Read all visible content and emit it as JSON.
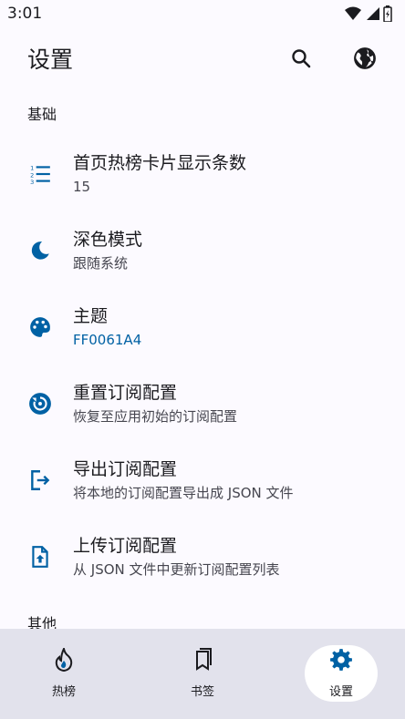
{
  "status_bar": {
    "time": "3:01"
  },
  "header": {
    "title": "设置"
  },
  "sections": {
    "basic": "基础",
    "other": "其他"
  },
  "settings": [
    {
      "title": "首页热榜卡片显示条数",
      "subtitle": "15",
      "icon": "list-numbered-icon"
    },
    {
      "title": "深色模式",
      "subtitle": "跟随系统",
      "icon": "moon-icon"
    },
    {
      "title": "主题",
      "subtitle": "FF0061A4",
      "icon": "palette-icon"
    },
    {
      "title": "重置订阅配置",
      "subtitle": "恢复至应用初始的订阅配置",
      "icon": "reset-icon"
    },
    {
      "title": "导出订阅配置",
      "subtitle": "将本地的订阅配置导出成 JSON 文件",
      "icon": "export-icon"
    },
    {
      "title": "上传订阅配置",
      "subtitle": "从 JSON 文件中更新订阅配置列表",
      "icon": "upload-file-icon"
    }
  ],
  "bottom_nav": [
    {
      "label": "热榜",
      "icon": "flame-icon"
    },
    {
      "label": "书签",
      "icon": "bookmarks-icon"
    },
    {
      "label": "设置",
      "icon": "gear-icon",
      "active": true
    }
  ],
  "colors": {
    "accent": "#0061A4",
    "background": "#FCFAFF",
    "nav_bg": "#E2E2EC"
  }
}
